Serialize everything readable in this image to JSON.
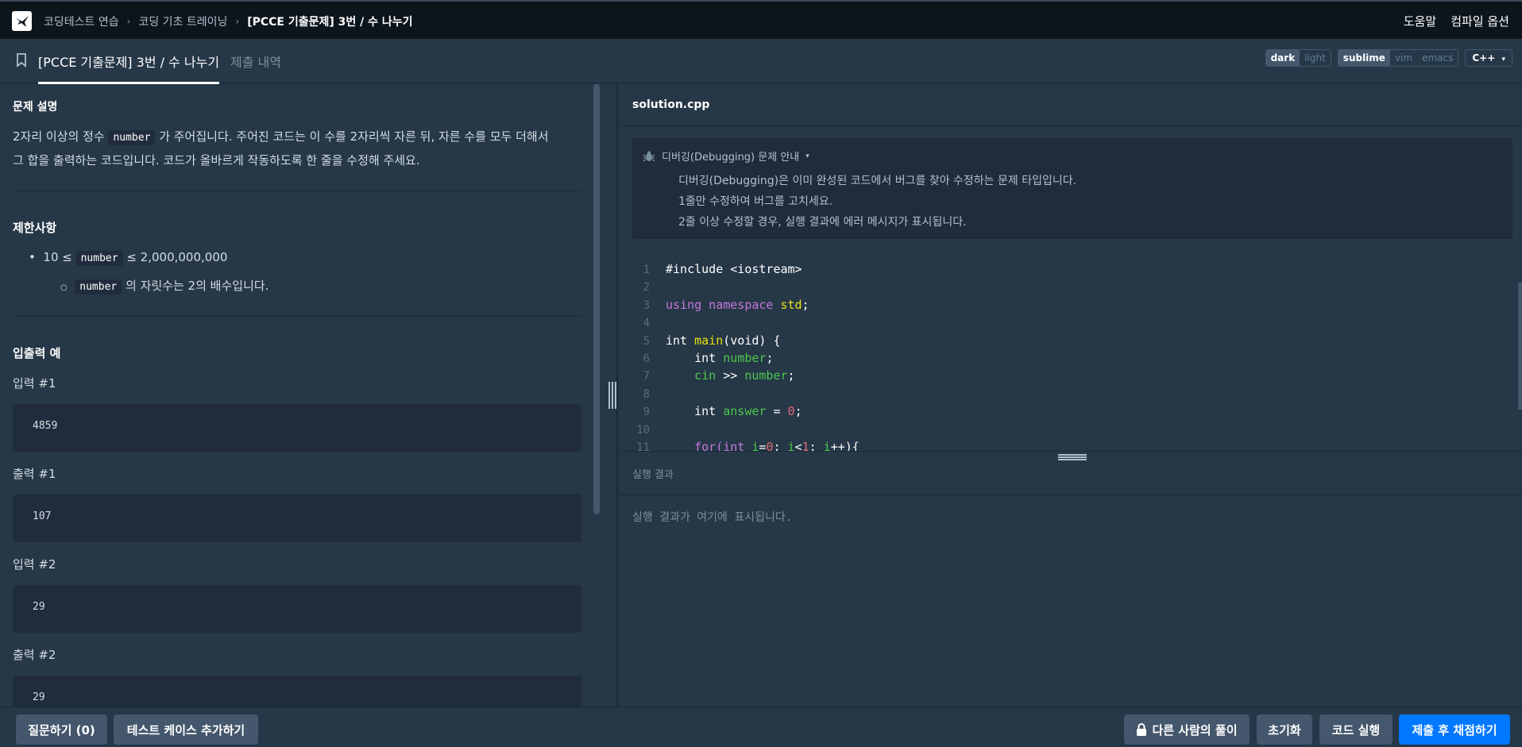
{
  "nav": {
    "crumbs": [
      "코딩테스트 연습",
      "코딩 기초 트레이닝",
      "[PCCE 기출문제] 3번 / 수 나누기"
    ],
    "help": "도움말",
    "compile_options": "컴파일 옵션"
  },
  "tabs": {
    "active": "[PCCE 기출문제] 3번 / 수 나누기",
    "history": "제출 내역"
  },
  "theme": {
    "dark": "dark",
    "light": "light"
  },
  "keymap": {
    "sublime": "sublime",
    "vim": "vim",
    "emacs": "emacs"
  },
  "language": "C++",
  "problem": {
    "desc_title": "문제 설명",
    "desc_part1": "2자리 이상의 정수 ",
    "desc_code": "number",
    "desc_part2": " 가 주어집니다. 주어진 코드는 이 수를 2자리씩 자른 뒤, 자른 수를 모두 더해서",
    "desc_line2": "그 합을 출력하는 코드입니다. 코드가 올바르게 작동하도록 한 줄을 수정해 주세요.",
    "constraints_title": "제한사항",
    "c1_pre": "10 ≤ ",
    "c1_code": "number",
    "c1_post": " ≤ 2,000,000,000",
    "c2_code": "number",
    "c2_post": " 의 자릿수는 2의 배수입니다.",
    "io_title": "입출력 예",
    "examples": [
      {
        "label": "입력 #1",
        "value": "4859"
      },
      {
        "label": "출력 #1",
        "value": "107"
      },
      {
        "label": "입력 #2",
        "value": "29"
      },
      {
        "label": "출력 #2",
        "value": "29"
      }
    ]
  },
  "editor": {
    "filename": "solution.cpp",
    "debug_title": "디버깅(Debugging) 문제 안내",
    "debug_lines": [
      "디버깅(Debugging)은 이미 완성된 코드에서 버그를 찾아 수정하는 문제 타입입니다.",
      "1줄만 수정하여 버그를 고치세요.",
      "2줄 이상 수정할 경우, 실행 결과에 에러 메시지가 표시됩니다."
    ],
    "line_numbers": [
      "1",
      "2",
      "3",
      "4",
      "5",
      "6",
      "7",
      "8",
      "9",
      "10",
      "11"
    ],
    "code": {
      "l1": "#include <iostream>",
      "l3_kw": "using namespace",
      "l3_std": "std",
      "l3_end": ";",
      "l5_int": "int ",
      "l5_main": "main",
      "l5_rest": "(void) {",
      "l6_int": "    int ",
      "l6_var": "number",
      "l6_end": ";",
      "l7_cin": "    cin",
      "l7_op": " >> ",
      "l7_var": "number",
      "l7_end": ";",
      "l9_int": "    int ",
      "l9_var": "answer",
      "l9_eq": " = ",
      "l9_num": "0",
      "l9_end": ";",
      "l11_for": "    for(int ",
      "l11_i1": "i",
      "l11_eq": "=",
      "l11_zero": "0",
      "l11_semi1": "; ",
      "l11_i2": "i",
      "l11_lt": "<",
      "l11_one": "1",
      "l11_semi2": "; ",
      "l11_i3": "i",
      "l11_end": "++){"
    }
  },
  "result": {
    "title": "실행 결과",
    "placeholder": "실행 결과가 여기에 표시됩니다."
  },
  "bottom": {
    "question": "질문하기 (0)",
    "add_testcase": "테스트 케이스 추가하기",
    "others_solution": "다른 사람의 풀이",
    "reset": "초기화",
    "run": "코드 실행",
    "submit": "제출 후 채점하기"
  }
}
